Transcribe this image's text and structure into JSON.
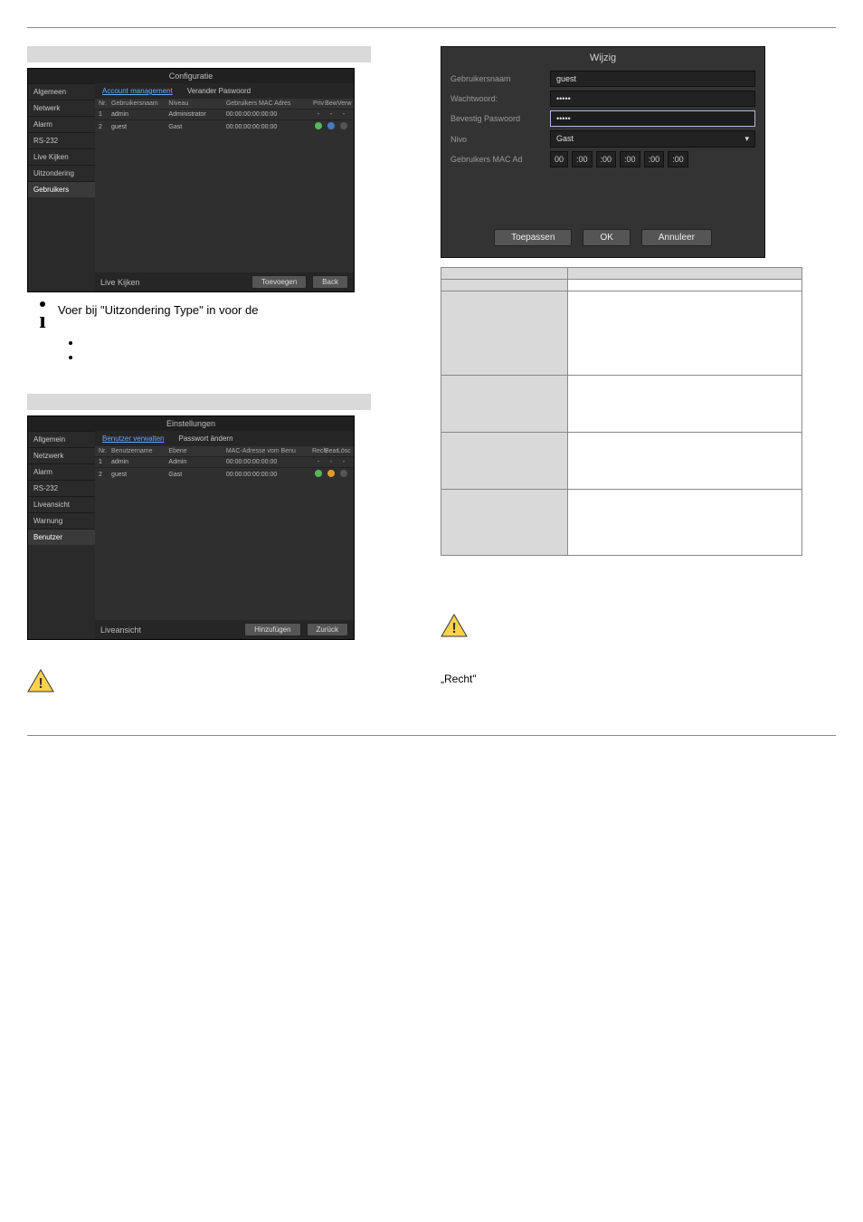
{
  "topSectionBar": {
    "left": "",
    "right": ""
  },
  "panelA": {
    "title": "Configuratie",
    "sidebar": [
      "Algemeen",
      "Netwerk",
      "Alarm",
      "RS-232",
      "Live Kijken",
      "Uitzondering",
      "Gebruikers"
    ],
    "sidebarSelectedIndex": 6,
    "tabs": [
      "Account management",
      "Verander Paswoord"
    ],
    "tabActiveIndex": 0,
    "headers": [
      "Nr.",
      "Gebruikersnaam",
      "Niveau",
      "Gebruikers MAC Adres",
      "Priv",
      "Bew",
      "Verw"
    ],
    "rows": [
      {
        "nr": "1",
        "user": "admin",
        "level": "Administrator",
        "mac": "00:00:00:00:00:00",
        "a": "-",
        "b": "-",
        "c": "-"
      },
      {
        "nr": "2",
        "user": "guest",
        "level": "Gast",
        "mac": "00:00:00:00:00:00",
        "a": "●",
        "b": "●",
        "c": "●"
      }
    ],
    "footerLeft": "Live Kijken",
    "footerBtnPrimary": "Toevoegen",
    "footerBtnBack": "Back"
  },
  "dialog": {
    "title": "Wijzig",
    "rows": {
      "gebruikersnaam": {
        "label": "Gebruikersnaam",
        "value": "guest"
      },
      "wachtwoord": {
        "label": "Wachtwoord:",
        "value": "•••••"
      },
      "bevestig": {
        "label": "Bevestig Paswoord",
        "value": "•••••"
      },
      "nivo": {
        "label": "Nivo",
        "value": "Gast"
      },
      "mac": {
        "label": "Gebruikers MAC Ad",
        "parts": [
          "00",
          ":00",
          ":00",
          ":00",
          ":00",
          ":00"
        ]
      }
    },
    "buttons": [
      "Toepassen",
      "OK",
      "Annuleer"
    ]
  },
  "infoText": "Voer bij \"Uitzondering Type\" in voor de",
  "bullets": [
    "",
    ""
  ],
  "sectionBar2": {
    "left": "",
    "right": ""
  },
  "panelB": {
    "title": "Einstellungen",
    "sidebar": [
      "Allgemein",
      "Netzwerk",
      "Alarm",
      "RS-232",
      "Liveansicht",
      "Warnung",
      "Benutzer"
    ],
    "sidebarSelectedIndex": 6,
    "tabs": [
      "Benutzer verwalten",
      "Passwort ändern"
    ],
    "tabActiveIndex": 0,
    "headers": [
      "Nr.",
      "Benutzername",
      "Ebene",
      "MAC-Adresse vom Benu",
      "Rech",
      "Bear",
      "Lösc"
    ],
    "rows": [
      {
        "nr": "1",
        "user": "admin",
        "level": "Admin",
        "mac": "00:00:00:00:00:00",
        "a": "-",
        "b": "-",
        "c": "-"
      },
      {
        "nr": "2",
        "user": "guest",
        "level": "Gast",
        "mac": "00:00:00:00:00:00",
        "a": "●",
        "b": "■",
        "c": "●"
      }
    ],
    "footerLeft": "Liveansicht",
    "footerBtnPrimary": "Hinzufügen",
    "footerBtnBack": "Zurück"
  },
  "refTable": {
    "r1c1": "",
    "r1c2": "",
    "r2c1": "",
    "r2c2": "",
    "r3c1": "",
    "r3c2": "",
    "r4c1": "",
    "r4c2": "",
    "r5c1": "",
    "r5c2": "",
    "r6c1": "",
    "r6c2": ""
  },
  "lowerLeftPara1": "",
  "lowerLeftPara2": "",
  "rightWord": "„Recht\"",
  "rightParas": [
    "",
    "",
    "",
    ""
  ],
  "footerPage": ""
}
